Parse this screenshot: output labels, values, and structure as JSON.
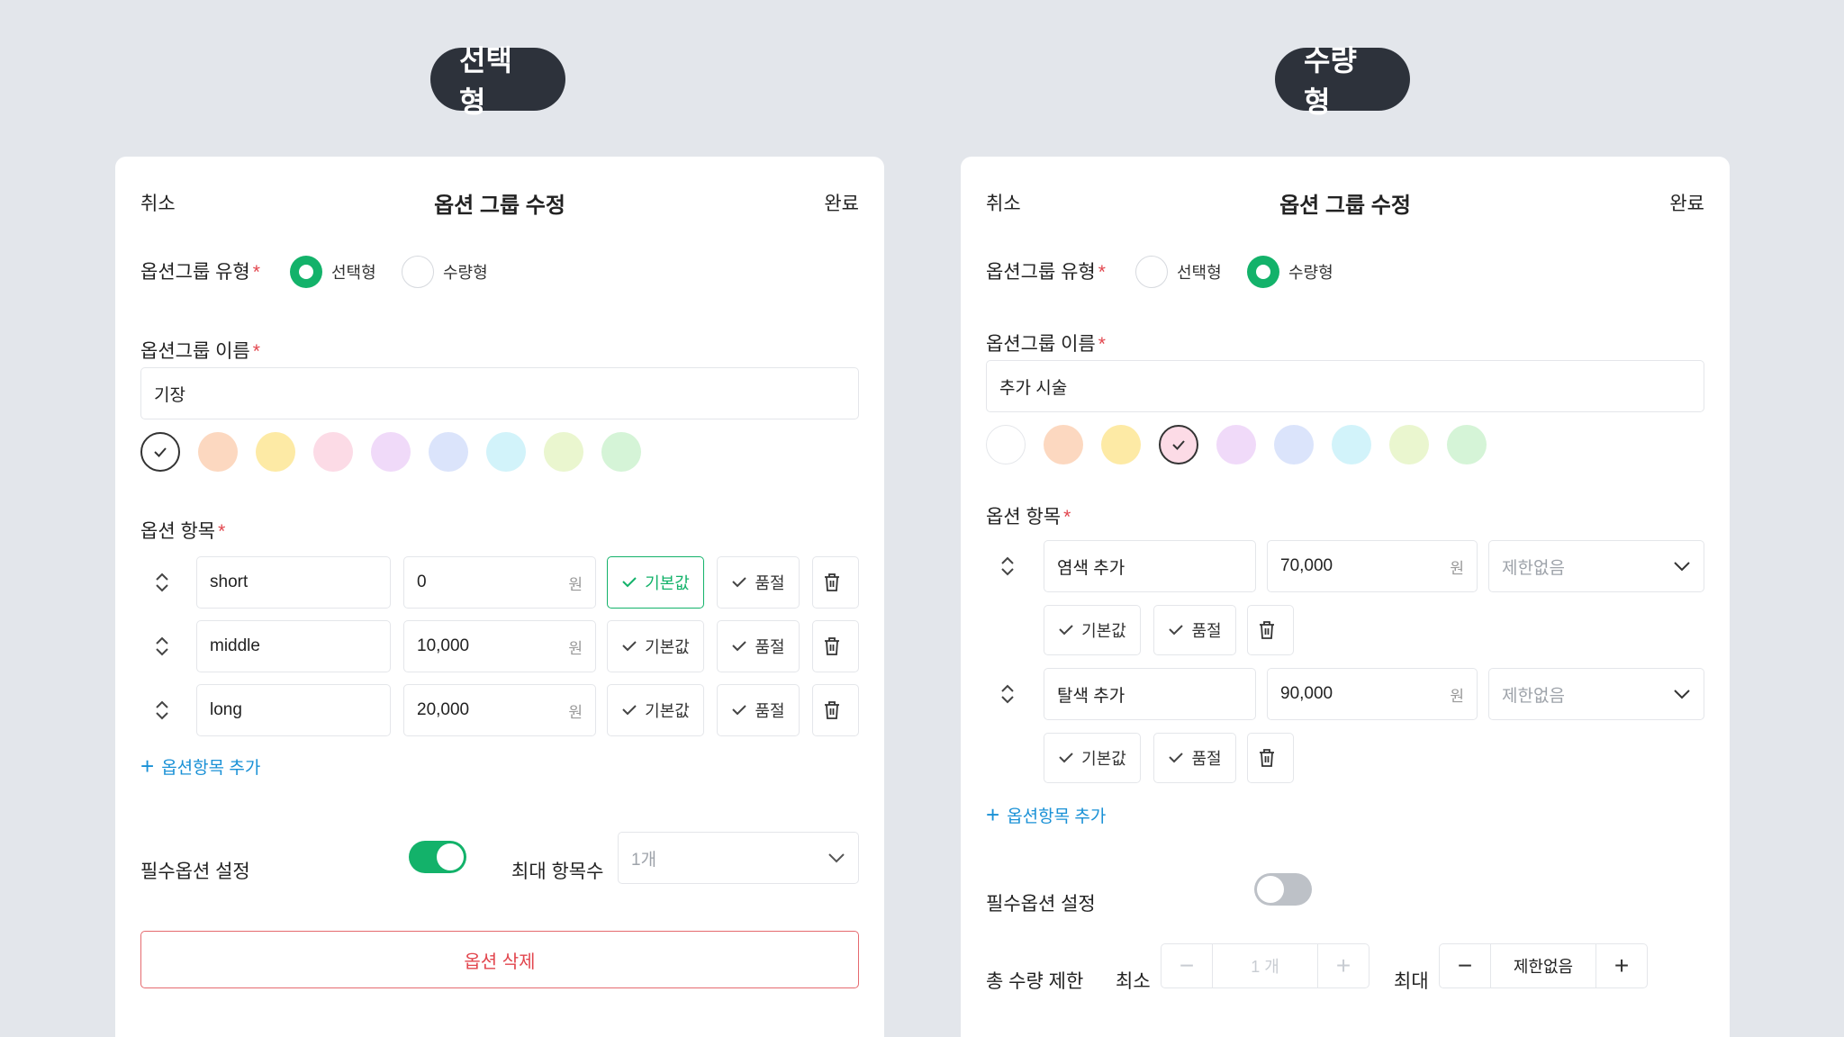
{
  "left": {
    "pill": "선택형",
    "header": {
      "cancel": "취소",
      "title": "옵션 그룹 수정",
      "done": "완료"
    },
    "type_label": "옵션그룹 유형",
    "type_options": [
      {
        "label": "선택형",
        "selected": true
      },
      {
        "label": "수량형",
        "selected": false
      }
    ],
    "name_label": "옵션그룹 이름",
    "name_value": "기장",
    "colors": [
      "#ffffff",
      "#fcd8c0",
      "#fdeaa5",
      "#fcdbe6",
      "#f0daf9",
      "#dbe4fb",
      "#d2f3fa",
      "#eaf6cf",
      "#d5f4d7"
    ],
    "selected_color_index": 0,
    "items_label": "옵션 항목",
    "items": [
      {
        "name": "short",
        "price": "0",
        "unit": "원",
        "default_label": "기본값",
        "is_default": true,
        "soldout_label": "품절"
      },
      {
        "name": "middle",
        "price": "10,000",
        "unit": "원",
        "default_label": "기본값",
        "is_default": false,
        "soldout_label": "품절"
      },
      {
        "name": "long",
        "price": "20,000",
        "unit": "원",
        "default_label": "기본값",
        "is_default": false,
        "soldout_label": "품절"
      }
    ],
    "add_item": "옵션항목 추가",
    "required_label": "필수옵션 설정",
    "required_on": true,
    "max_label": "최대 항목수",
    "max_value": "1개",
    "delete_label": "옵션 삭제"
  },
  "right": {
    "pill": "수량형",
    "header": {
      "cancel": "취소",
      "title": "옵션 그룹 수정",
      "done": "완료"
    },
    "type_label": "옵션그룹 유형",
    "type_options": [
      {
        "label": "선택형",
        "selected": false
      },
      {
        "label": "수량형",
        "selected": true
      }
    ],
    "name_label": "옵션그룹 이름",
    "name_value": "추가 시술",
    "colors": [
      "#ffffff",
      "#fcd8c0",
      "#fdeaa5",
      "#fcdbe6",
      "#f0daf9",
      "#dbe4fb",
      "#d2f3fa",
      "#eaf6cf",
      "#d5f4d7"
    ],
    "selected_color_index": 3,
    "items_label": "옵션 항목",
    "items": [
      {
        "name": "염색 추가",
        "price": "70,000",
        "unit": "원",
        "limit": "제한없음",
        "default_label": "기본값",
        "soldout_label": "품절"
      },
      {
        "name": "탈색 추가",
        "price": "90,000",
        "unit": "원",
        "limit": "제한없음",
        "default_label": "기본값",
        "soldout_label": "품절"
      }
    ],
    "add_item": "옵션항목 추가",
    "required_label": "필수옵션 설정",
    "required_on": false,
    "total_label": "총 수량 제한",
    "min_label": "최소",
    "min_value": "1 개",
    "max_label": "최대",
    "max_value": "제한없음"
  }
}
